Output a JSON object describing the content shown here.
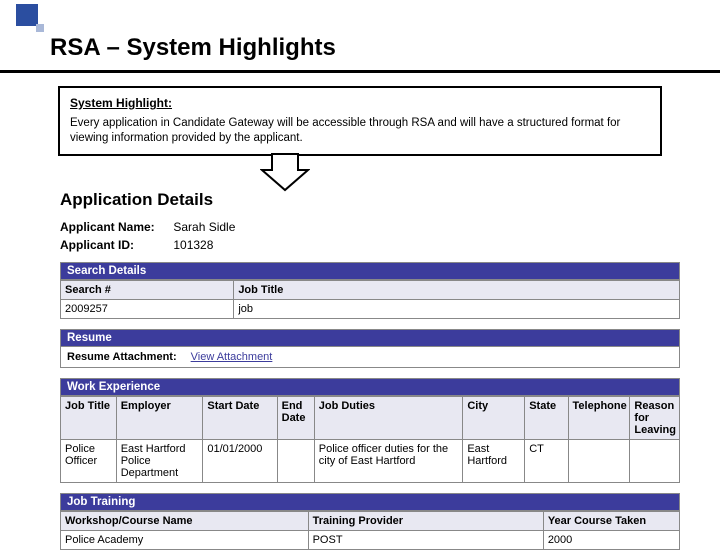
{
  "slide": {
    "title": "RSA – System Highlights"
  },
  "highlight": {
    "heading": "System Highlight:",
    "body": "Every application in Candidate Gateway will be accessible through RSA and will have a structured format for viewing information provided by the applicant."
  },
  "appDetails": {
    "heading": "Application Details",
    "nameLabel": "Applicant Name:",
    "nameValue": "Sarah Sidle",
    "idLabel": "Applicant ID:",
    "idValue": "101328"
  },
  "searchDetails": {
    "bar": "Search Details",
    "cols": {
      "searchNum": "Search #",
      "jobTitle": "Job Title"
    },
    "row": {
      "searchNum": "2009257",
      "jobTitle": "job"
    }
  },
  "resume": {
    "bar": "Resume",
    "attachmentLabel": "Resume Attachment:",
    "viewLink": "View Attachment"
  },
  "workExp": {
    "bar": "Work Experience",
    "cols": {
      "jobTitle": "Job Title",
      "employer": "Employer",
      "start": "Start Date",
      "end": "End Date",
      "duties": "Job Duties",
      "city": "City",
      "state": "State",
      "tel": "Telephone",
      "reason": "Reason for Leaving"
    },
    "row": {
      "jobTitle": "Police Officer",
      "employer": "East Hartford Police Department",
      "start": "01/01/2000",
      "end": "",
      "duties": "Police officer duties for the city of East Hartford",
      "city": "East Hartford",
      "state": "CT",
      "tel": "",
      "reason": ""
    }
  },
  "jobTraining": {
    "bar": "Job Training",
    "cols": {
      "name": "Workshop/Course Name",
      "provider": "Training Provider",
      "year": "Year Course Taken"
    },
    "row": {
      "name": "Police Academy",
      "provider": "POST",
      "year": "2000"
    }
  }
}
